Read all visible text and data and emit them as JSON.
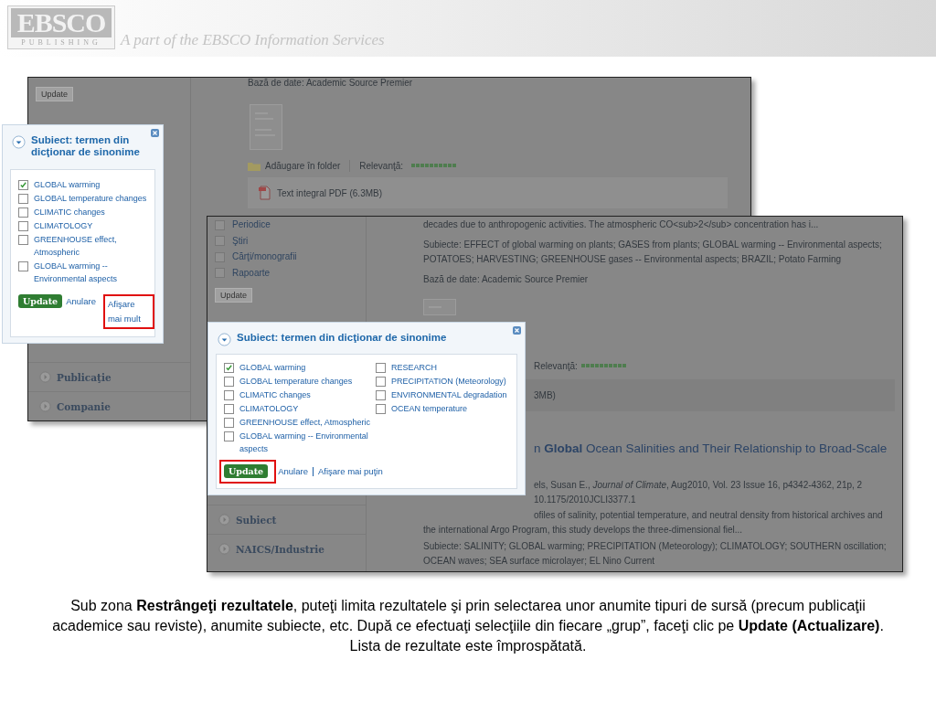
{
  "header": {
    "logo": "EBSCO",
    "logo_subtitle": "PUBLISHING",
    "tagline": "A part of the EBSCO Information Services"
  },
  "screenshot_back": {
    "sidebar": {
      "button": "Update",
      "sections": [
        "Publicaţie",
        "Companie"
      ]
    },
    "result": {
      "database": "Bază de date: Academic Source Premier",
      "add_to_folder": "Adăugare în folder",
      "relevance_label": "Relevanţă:",
      "full_text": "Text integral PDF (6.3MB)"
    },
    "popup": {
      "title": "Subiect: termen din dicţionar de sinonime",
      "columns": [
        [
          {
            "label": "GLOBAL warming",
            "checked": true
          },
          {
            "label": "GLOBAL temperature changes",
            "checked": false
          },
          {
            "label": "CLIMATIC changes",
            "checked": false
          },
          {
            "label": "CLIMATOLOGY",
            "checked": false
          },
          {
            "label": "GREENHOUSE effect, Atmospheric",
            "checked": false
          },
          {
            "label": "GLOBAL warming -- Environmental aspects",
            "checked": false
          }
        ]
      ],
      "update": {
        "label": "Update",
        "highlighted": false
      },
      "cancel": "Anulare",
      "toggle": {
        "label": "Afişare mai mult",
        "highlighted": true
      }
    }
  },
  "screenshot_front": {
    "sidebar": {
      "source_types": [
        {
          "label": "Periodice",
          "checked": false
        },
        {
          "label": "Ştiri",
          "checked": false
        },
        {
          "label": "Cărţi/monografii",
          "checked": false
        },
        {
          "label": "Rapoarte",
          "checked": false
        }
      ],
      "button": "Update",
      "sections": [
        "Subiect",
        "NAICS/Industrie"
      ]
    },
    "blocks": [
      {
        "kind": "text",
        "lines": [
          {
            "text": "decades due to anthropogenic activities. The atmospheric CO<sub>2</sub> concentration has i...",
            "covered": false
          }
        ]
      },
      {
        "kind": "text",
        "lines": [
          {
            "text": "Subiecte: EFFECT of global warming on plants; GASES from plants; GLOBAL warming -- Environmental aspects;",
            "covered": false
          },
          {
            "text": "POTATOES; HARVESTING; GREENHOUSE gases -- Environmental aspects; BRAZIL; Potato Farming",
            "covered": false
          }
        ]
      },
      {
        "kind": "text",
        "lines": [
          {
            "text": "Bază de date: Academic Source Premier",
            "covered": false
          }
        ]
      },
      {
        "kind": "thumbnail"
      },
      {
        "kind": "relevance",
        "lines": [
          {
            "text": "Relevanţă:",
            "covered": true
          }
        ]
      },
      {
        "kind": "fulltext",
        "lines": [
          {
            "text": "3MB)",
            "covered": true
          }
        ]
      },
      {
        "kind": "title",
        "lines": [
          {
            "text": "n **Global** Ocean Salinities and Their Relationship to Broad-Scale",
            "covered": true
          }
        ]
      },
      {
        "kind": "text",
        "lines": [
          {
            "text": "els, Susan E., *Journal of Climate*, Aug2010, Vol. 23 Issue 16, p4342-4362, 21p, 2",
            "covered": true
          },
          {
            "text": "10.1175/2010JCLI3377.1",
            "covered": true
          }
        ]
      },
      {
        "kind": "text",
        "lines": [
          {
            "text": "ofiles of salinity, potential temperature, and neutral density from historical archives and",
            "covered": true
          },
          {
            "text": "the international Argo Program, this study develops the three-dimensional fiel...",
            "covered": false
          }
        ]
      },
      {
        "kind": "text",
        "lines": [
          {
            "text": "Subiecte: SALINITY; GLOBAL warming; PRECIPITATION (Meteorology); CLIMATOLOGY; SOUTHERN oscillation;",
            "covered": false
          },
          {
            "text": "OCEAN waves; SEA surface microlayer; EL Nino Current",
            "covered": false
          }
        ]
      }
    ],
    "popup": {
      "title": "Subiect: termen din dicţionar de sinonime",
      "columns": [
        [
          {
            "label": "GLOBAL warming",
            "checked": true
          },
          {
            "label": "GLOBAL temperature changes",
            "checked": false
          },
          {
            "label": "CLIMATIC changes",
            "checked": false
          },
          {
            "label": "CLIMATOLOGY",
            "checked": false
          },
          {
            "label": "GREENHOUSE effect, Atmospheric",
            "checked": false
          },
          {
            "label": "GLOBAL warming -- Environmental aspects",
            "checked": false
          }
        ],
        [
          {
            "label": "RESEARCH",
            "checked": false
          },
          {
            "label": "PRECIPITATION (Meteorology)",
            "checked": false
          },
          {
            "label": "ENVIRONMENTAL degradation",
            "checked": false
          },
          {
            "label": "OCEAN temperature",
            "checked": false
          }
        ]
      ],
      "update": {
        "label": "Update",
        "highlighted": true
      },
      "cancel": "Anulare",
      "toggle": {
        "label": "Afişare mai puţin",
        "highlighted": false
      }
    }
  },
  "caption": "Sub zona **Restrângeţi rezultatele**, puteţi limita rezultatele şi prin selectarea unor anumite tipuri de sursă (precum publicaţii academice sau reviste), anumite subiecte, etc. După ce efectuaţi selecţiile din fiecare „grup”, faceţi clic pe **Update (Actualizare)**. Lista de rezultate este împrospătată."
}
